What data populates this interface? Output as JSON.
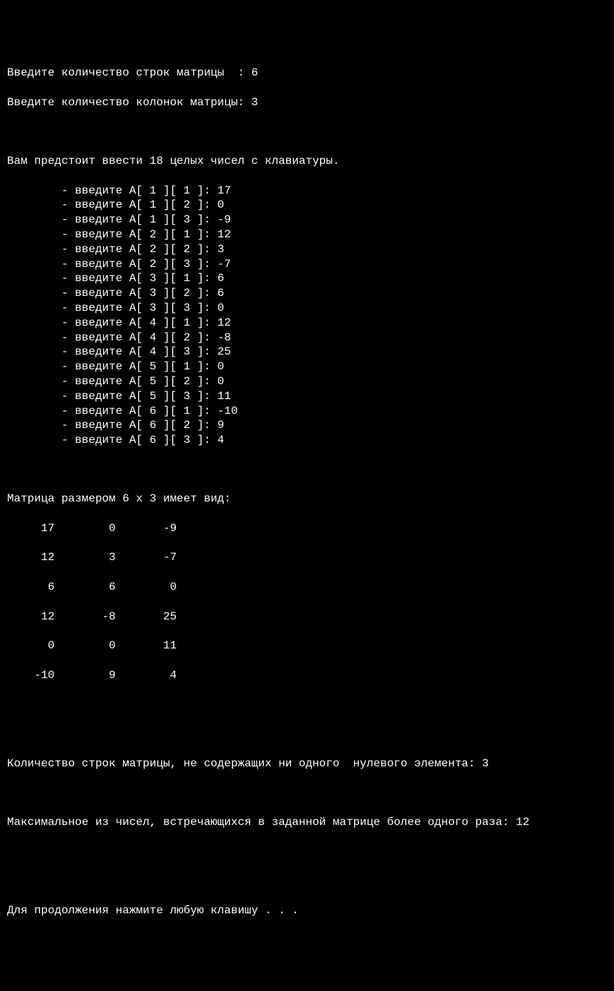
{
  "prompts": {
    "rows": "Введите количество строк матрицы  : ",
    "rows_value": "6",
    "cols": "Введите количество колонок матрицы: ",
    "cols_value": "3"
  },
  "intro": "Вам предстоит ввести 18 целых чисел с клавиатуры.",
  "inputs": [
    {
      "prefix": "        - введите A[ 1 ][ 1 ]: ",
      "value": "17"
    },
    {
      "prefix": "        - введите A[ 1 ][ 2 ]: ",
      "value": "0"
    },
    {
      "prefix": "        - введите A[ 1 ][ 3 ]: ",
      "value": "-9"
    },
    {
      "prefix": "        - введите A[ 2 ][ 1 ]: ",
      "value": "12"
    },
    {
      "prefix": "        - введите A[ 2 ][ 2 ]: ",
      "value": "3"
    },
    {
      "prefix": "        - введите A[ 2 ][ 3 ]: ",
      "value": "-7"
    },
    {
      "prefix": "        - введите A[ 3 ][ 1 ]: ",
      "value": "6"
    },
    {
      "prefix": "        - введите A[ 3 ][ 2 ]: ",
      "value": "6"
    },
    {
      "prefix": "        - введите A[ 3 ][ 3 ]: ",
      "value": "0"
    },
    {
      "prefix": "        - введите A[ 4 ][ 1 ]: ",
      "value": "12"
    },
    {
      "prefix": "        - введите A[ 4 ][ 2 ]: ",
      "value": "-8"
    },
    {
      "prefix": "        - введите A[ 4 ][ 3 ]: ",
      "value": "25"
    },
    {
      "prefix": "        - введите A[ 5 ][ 1 ]: ",
      "value": "0"
    },
    {
      "prefix": "        - введите A[ 5 ][ 2 ]: ",
      "value": "0"
    },
    {
      "prefix": "        - введите A[ 5 ][ 3 ]: ",
      "value": "11"
    },
    {
      "prefix": "        - введите A[ 6 ][ 1 ]: ",
      "value": "-10"
    },
    {
      "prefix": "        - введите A[ 6 ][ 2 ]: ",
      "value": "9"
    },
    {
      "prefix": "        - введите A[ 6 ][ 3 ]: ",
      "value": "4"
    }
  ],
  "matrix_header": "Матрица размером 6 x 3 имеет вид:",
  "matrix_rows": [
    "     17        0       -9",
    "     12        3       -7",
    "      6        6        0",
    "     12       -8       25",
    "      0        0       11",
    "    -10        9        4"
  ],
  "matrix_data": {
    "rows": 6,
    "cols": 3,
    "cells": [
      [
        17,
        0,
        -9
      ],
      [
        12,
        3,
        -7
      ],
      [
        6,
        6,
        0
      ],
      [
        12,
        -8,
        25
      ],
      [
        0,
        0,
        11
      ],
      [
        -10,
        9,
        4
      ]
    ]
  },
  "result1_label": "Количество строк матрицы, не содержащих ни одного  нулевого элемента: ",
  "result1_value": "3",
  "result2_label": "Максимальное из чисел, встречающихся в заданной матрице более одного раза: ",
  "result2_value": "12",
  "continue_prompt": "Для продолжения нажмите любую клавишу . . ."
}
